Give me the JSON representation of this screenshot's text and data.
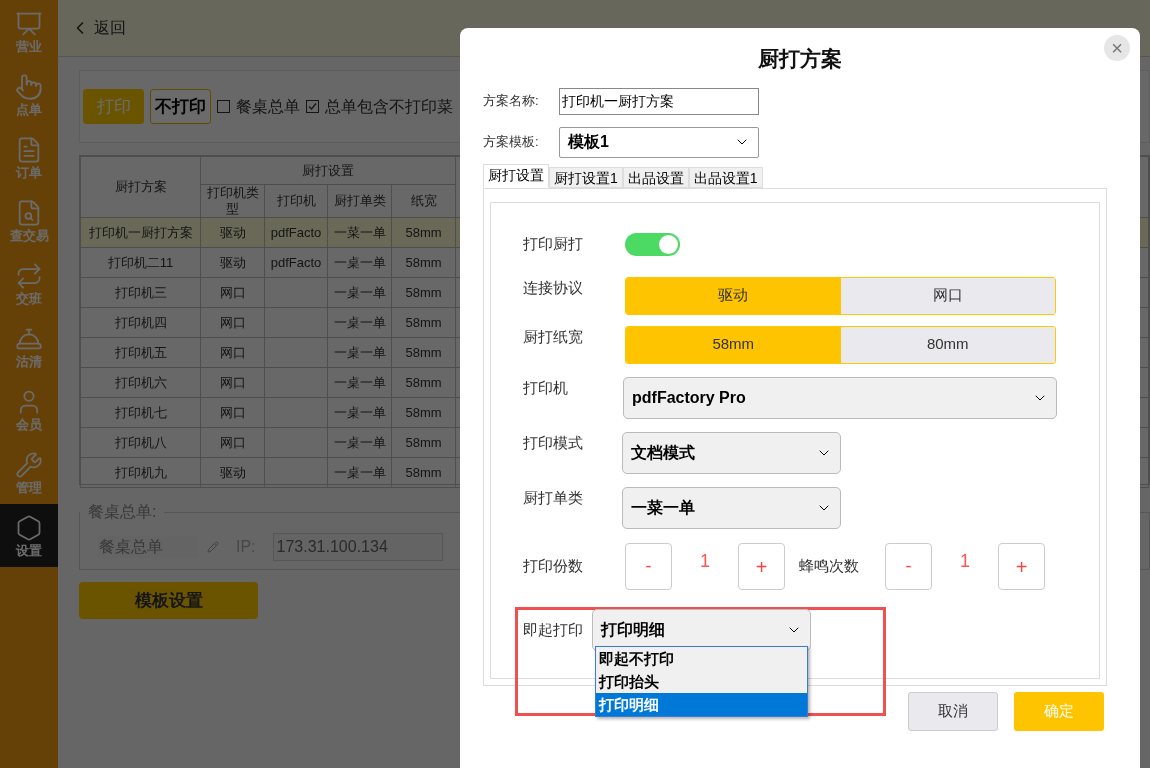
{
  "sidebar": {
    "items": [
      {
        "label": "营业",
        "selected": false
      },
      {
        "label": "点单",
        "selected": false
      },
      {
        "label": "订单",
        "selected": false
      },
      {
        "label": "查交易",
        "selected": false
      },
      {
        "label": "交班",
        "selected": false
      },
      {
        "label": "沽清",
        "selected": false
      },
      {
        "label": "会员",
        "selected": false
      },
      {
        "label": "管理",
        "selected": false
      },
      {
        "label": "设置",
        "selected": true
      }
    ]
  },
  "header": {
    "back": "返回"
  },
  "toolbar": {
    "buttons": [
      {
        "label": "打印",
        "selected": true
      },
      {
        "label": "不打印",
        "selected": false
      }
    ],
    "checkboxes": [
      {
        "label": "餐桌总单",
        "checked": false
      },
      {
        "label": "总单包含不打印菜",
        "checked": true
      }
    ]
  },
  "table": {
    "group": "厨打设置",
    "columns": [
      "厨打方案",
      "打印机类型",
      "打印机",
      "厨打单类",
      "纸宽"
    ],
    "rows": [
      {
        "cells": [
          "打印机一厨打方案",
          "驱动",
          "pdfFacto",
          "一菜一单",
          "58mm"
        ],
        "selected": true
      },
      {
        "cells": [
          "打印机二11",
          "驱动",
          "pdfFacto",
          "一桌一单",
          "58mm"
        ],
        "selected": false
      },
      {
        "cells": [
          "打印机三",
          "网口",
          "",
          "一桌一单",
          "58mm"
        ],
        "selected": false
      },
      {
        "cells": [
          "打印机四",
          "网口",
          "",
          "一桌一单",
          "58mm"
        ],
        "selected": false
      },
      {
        "cells": [
          "打印机五",
          "网口",
          "",
          "一桌一单",
          "58mm"
        ],
        "selected": false
      },
      {
        "cells": [
          "打印机六",
          "网口",
          "",
          "一桌一单",
          "58mm"
        ],
        "selected": false
      },
      {
        "cells": [
          "打印机七",
          "网口",
          "",
          "一桌一单",
          "58mm"
        ],
        "selected": false
      },
      {
        "cells": [
          "打印机八",
          "网口",
          "",
          "一桌一单",
          "58mm"
        ],
        "selected": false
      },
      {
        "cells": [
          "打印机九",
          "驱动",
          "",
          "一桌一单",
          "58mm"
        ],
        "selected": false
      }
    ]
  },
  "table_summary": {
    "legend": "餐桌总单:",
    "name": "餐桌总单",
    "ip_label": "IP:",
    "ip": "173.31.100.134"
  },
  "template_button": "模板设置",
  "dialog": {
    "title": "厨打方案",
    "close": "×",
    "name_label": "方案名称:",
    "name_value": "打印机一厨打方案",
    "template_label": "方案模板:",
    "template_value": "模板1",
    "tabs": [
      {
        "label": "厨打设置",
        "selected": true
      },
      {
        "label": "厨打设置1",
        "selected": false
      },
      {
        "label": "出品设置",
        "selected": false
      },
      {
        "label": "出品设置1",
        "selected": false
      }
    ],
    "settings": [
      {
        "kind": "toggle",
        "label": "打印厨打",
        "on": true
      },
      {
        "kind": "segmented",
        "label": "连接协议",
        "options": [
          {
            "label": "驱动",
            "selected": true
          },
          {
            "label": "网口",
            "selected": false
          }
        ]
      },
      {
        "kind": "segmented",
        "label": "厨打纸宽",
        "options": [
          {
            "label": "58mm",
            "selected": true
          },
          {
            "label": "80mm",
            "selected": false
          }
        ]
      },
      {
        "kind": "wide_select",
        "label": "打印机",
        "value": "pdfFactory Pro"
      },
      {
        "kind": "select",
        "label": "打印模式",
        "value": "文档模式"
      },
      {
        "kind": "select",
        "label": "厨打单类",
        "value": "一菜一单"
      },
      {
        "kind": "counters",
        "counters": [
          {
            "label": "打印份数",
            "minus": "-",
            "value": "1",
            "plus": "+"
          },
          {
            "label": "蜂鸣次数",
            "minus": "-",
            "value": "1",
            "plus": "+"
          }
        ]
      },
      {
        "kind": "open_select",
        "label": "即起打印",
        "value": "打印明细",
        "framed": true,
        "options": [
          {
            "label": "即起不打印",
            "selected": false
          },
          {
            "label": "打印抬头",
            "selected": false
          },
          {
            "label": "打印明细",
            "selected": true
          }
        ]
      }
    ],
    "buttons": [
      {
        "label": "取消",
        "kind": "secondary"
      },
      {
        "label": "确定",
        "kind": "primary"
      }
    ]
  }
}
